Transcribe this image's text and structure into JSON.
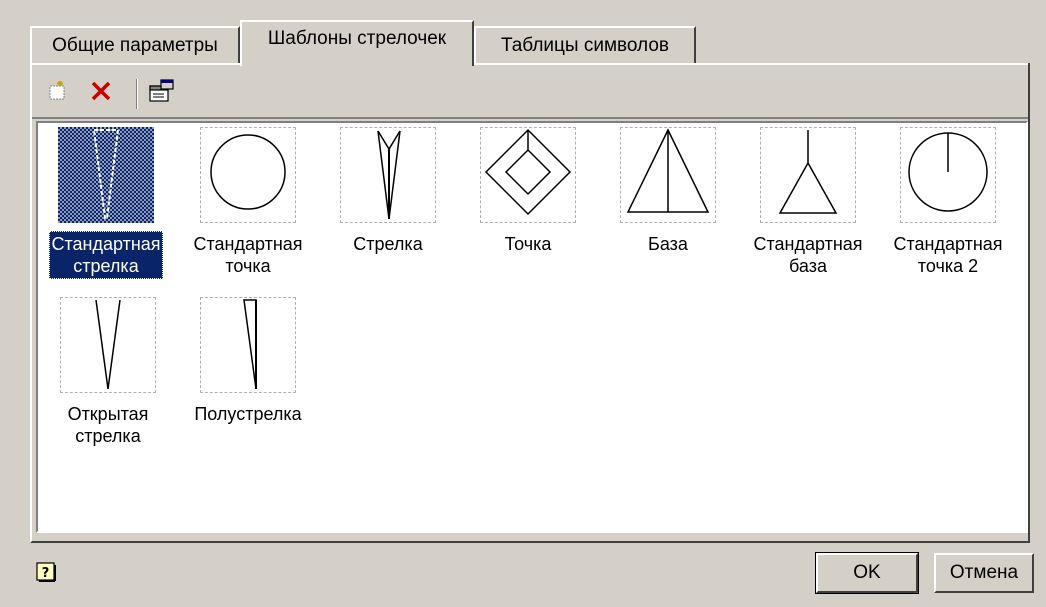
{
  "tabs": [
    {
      "label": "Общие параметры",
      "active": false
    },
    {
      "label": "Шаблоны стрелочек",
      "active": true
    },
    {
      "label": "Таблицы символов",
      "active": false
    }
  ],
  "toolbar": {
    "buttons": [
      {
        "icon": "new-item-icon"
      },
      {
        "icon": "delete-icon",
        "color": "#cc0000"
      },
      {
        "icon": "properties-icon"
      }
    ]
  },
  "templates": [
    {
      "label": "Стандартная\nстрелка",
      "icon": "standard-arrow-icon",
      "selected": true
    },
    {
      "label": "Стандартная\nточка",
      "icon": "standard-dot-icon",
      "selected": false
    },
    {
      "label": "Стрелка",
      "icon": "arrow-icon",
      "selected": false
    },
    {
      "label": "Точка",
      "icon": "dot-icon",
      "selected": false
    },
    {
      "label": "База",
      "icon": "base-icon",
      "selected": false
    },
    {
      "label": "Стандартная\nбаза",
      "icon": "standard-base-icon",
      "selected": false
    },
    {
      "label": "Стандартная\nточка 2",
      "icon": "standard-dot-2-icon",
      "selected": false
    },
    {
      "label": "Открытая\nстрелка",
      "icon": "open-arrow-icon",
      "selected": false
    },
    {
      "label": "Полустрелка",
      "icon": "half-arrow-icon",
      "selected": false
    }
  ],
  "footer": {
    "help_icon": "help-icon",
    "ok_label": "OK",
    "cancel_label": "Отмена"
  },
  "colors": {
    "selection": "#0a246a",
    "dialog_bg": "#d4d0c8"
  }
}
